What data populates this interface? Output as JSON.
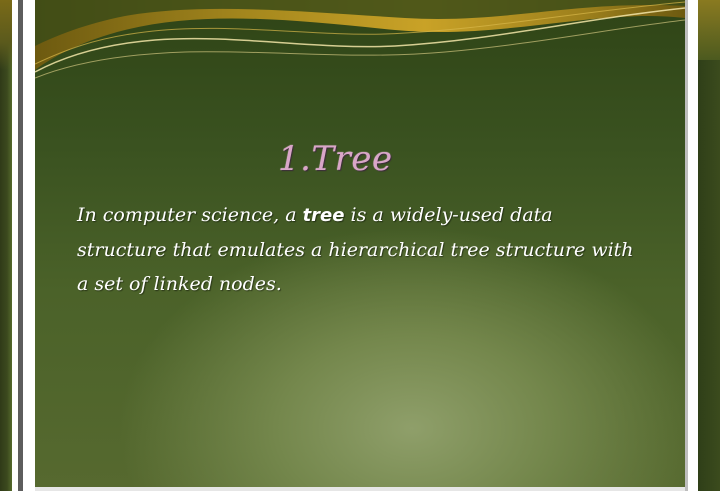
{
  "slide": {
    "title": "1.Tree",
    "body_before": "In computer science, a ",
    "body_bold": "tree",
    "body_after": " is a widely-used data structure that emulates a hierarchical tree structure with a set of linked nodes."
  },
  "colors": {
    "title": "#d9a6c8",
    "body_text": "#ffffff",
    "slide_background": "#3a5220",
    "swoosh_gold": "#c9a227"
  }
}
